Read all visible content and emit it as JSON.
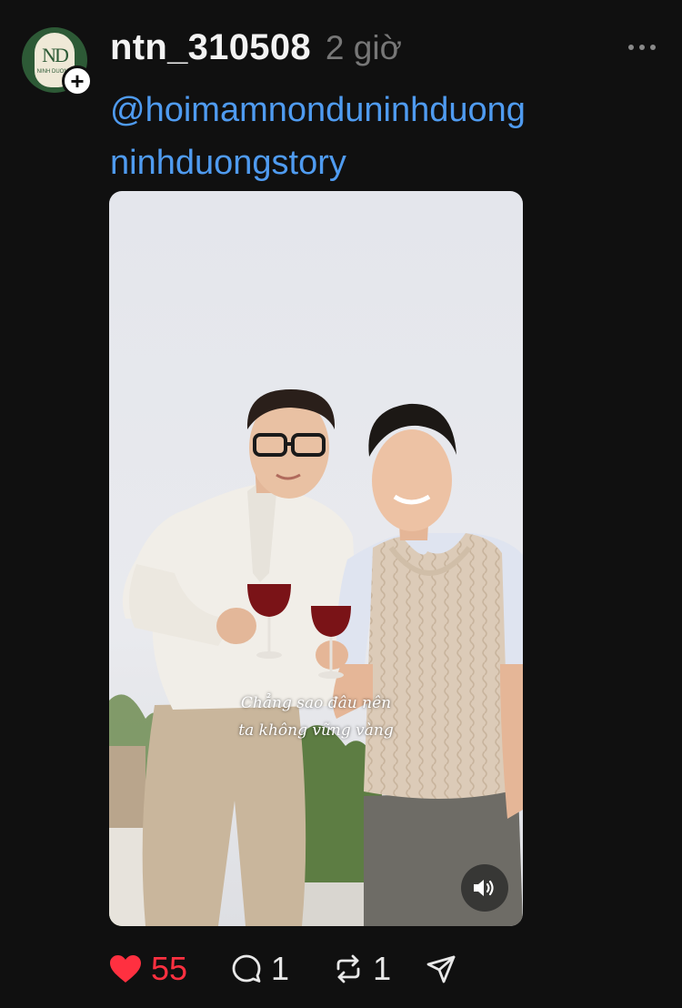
{
  "post": {
    "author": {
      "username": "ntn_310508",
      "avatar_monogram": "ND",
      "avatar_subtext": "NINH DUONG"
    },
    "timestamp": "2 giờ",
    "caption": {
      "mention": "@hoimamnonduninhduong",
      "tag": "ninhduongstory"
    },
    "media": {
      "type": "video",
      "subtitle_line1": "Chẳng sao đâu nên",
      "subtitle_line2": "ta không vững vàng"
    },
    "stats": {
      "likes": "55",
      "replies": "1",
      "reposts": "1"
    }
  },
  "colors": {
    "background": "#101010",
    "link": "#4f9bf0",
    "like": "#ff3040",
    "muted": "#777777"
  },
  "icons": [
    "plus-icon",
    "more-icon",
    "speaker-icon",
    "heart-icon",
    "reply-icon",
    "repost-icon",
    "share-icon"
  ]
}
